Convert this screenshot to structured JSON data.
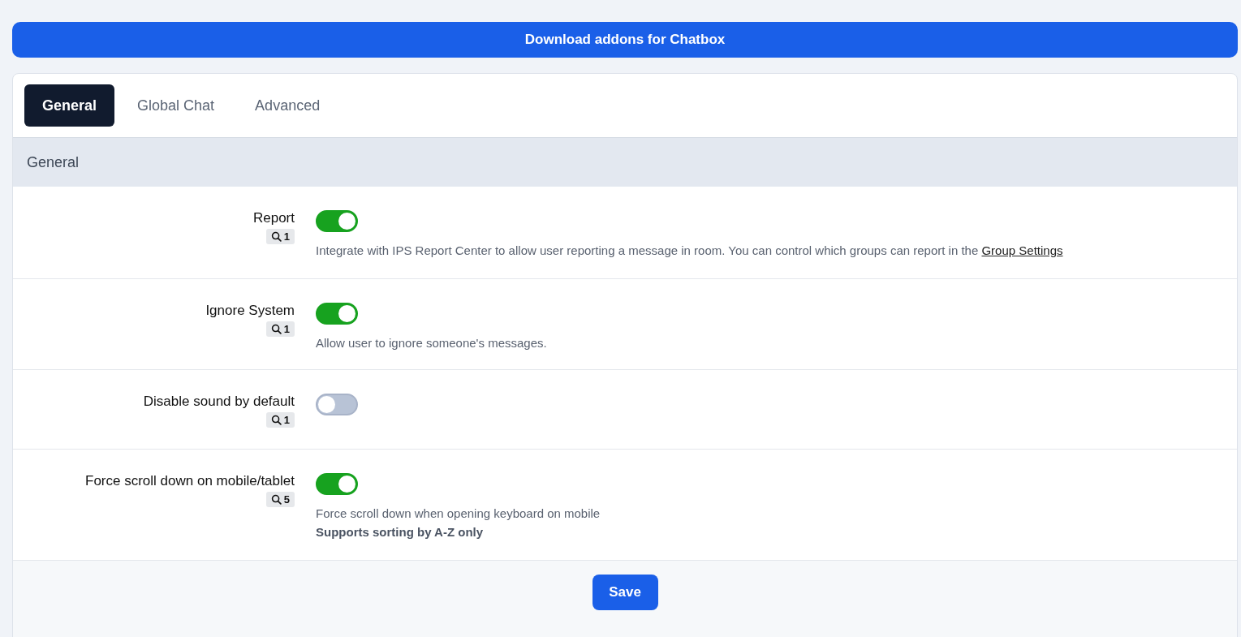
{
  "banner": {
    "label": "Download addons for Chatbox"
  },
  "tabs": [
    {
      "label": "General",
      "selected": true
    },
    {
      "label": "Global Chat",
      "selected": false
    },
    {
      "label": "Advanced",
      "selected": false
    }
  ],
  "section": {
    "title": "General"
  },
  "settings": [
    {
      "label": "Report",
      "count": "1",
      "on": true,
      "description": "Integrate with IPS Report Center to allow user reporting a message in room. You can control which groups can report in the",
      "link": "Group Settings"
    },
    {
      "label": "Ignore System",
      "count": "1",
      "on": true,
      "description": "Allow user to ignore someone's messages."
    },
    {
      "label": "Disable sound by default",
      "count": "1",
      "on": false
    },
    {
      "label": "Force scroll down on mobile/tablet",
      "count": "5",
      "on": true,
      "description": "Force scroll down when opening keyboard on mobile",
      "note": "Supports sorting by A-Z only"
    }
  ],
  "footer": {
    "save_button": "Save"
  }
}
